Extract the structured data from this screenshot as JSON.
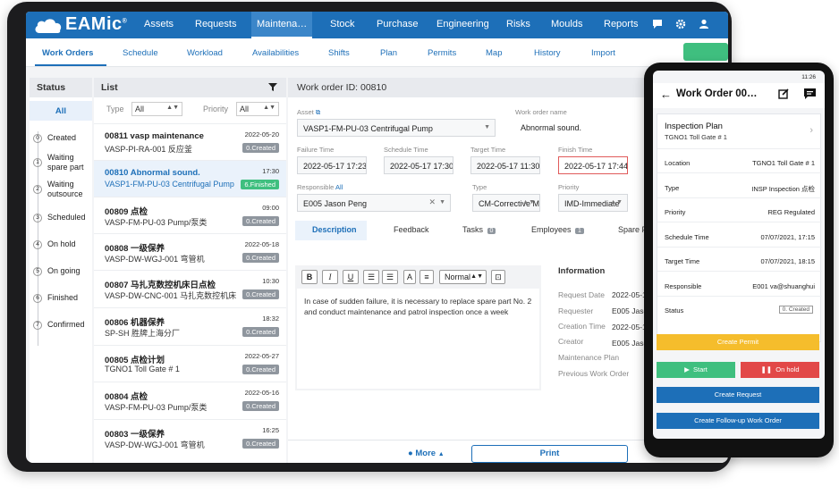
{
  "app": {
    "logo": "EAMic",
    "logo_mark": "®",
    "nav": [
      "Assets",
      "Requests",
      "Maintena…",
      "Stock",
      "Purchase",
      "Engineering",
      "Risks",
      "Moulds",
      "Reports"
    ],
    "subnav": [
      "Work Orders",
      "Schedule",
      "Workload",
      "Availabilities",
      "Shifts",
      "Plan",
      "Permits",
      "Map",
      "History",
      "Import"
    ]
  },
  "status": {
    "header": "Status",
    "all": "All",
    "items": [
      {
        "num": "0",
        "label": "Created"
      },
      {
        "num": "1",
        "label": "Waiting spare part"
      },
      {
        "num": "2",
        "label": "Waiting outsource"
      },
      {
        "num": "3",
        "label": "Scheduled"
      },
      {
        "num": "4",
        "label": "On hold"
      },
      {
        "num": "5",
        "label": "On going"
      },
      {
        "num": "6",
        "label": "Finished"
      },
      {
        "num": "7",
        "label": "Confirmed"
      }
    ]
  },
  "list": {
    "header": "List",
    "type_label": "Type",
    "type_value": "All",
    "priority_label": "Priority",
    "priority_value": "All",
    "rows": [
      {
        "title": "00811 vasp maintenance",
        "sub": "VASP-PI-RA-001 反应釜",
        "date": "2022-05-20",
        "badge": "0.Created"
      },
      {
        "title": "00810 Abnormal sound.",
        "sub": "VASP1-FM-PU-03 Centrifugal Pump",
        "date": "17:30",
        "badge": "6.Finished"
      },
      {
        "title": "00809 点检",
        "sub": "VASP-FM-PU-03 Pump/泵类",
        "date": "09:00",
        "badge": "0.Created"
      },
      {
        "title": "00808 一级保养",
        "sub": "VASP-DW-WGJ-001 弯管机",
        "date": "2022-05-18",
        "badge": "0.Created"
      },
      {
        "title": "00807 马扎克数控机床日点检",
        "sub": "VASP-DW-CNC-001 马扎克数控机床",
        "date": "10:30",
        "badge": "0.Created"
      },
      {
        "title": "00806 机器保养",
        "sub": "SP-SH 胜牌上海分厂",
        "date": "18:32",
        "badge": "0.Created"
      },
      {
        "title": "00805 点检计划",
        "sub": "TGNO1 Toll Gate # 1",
        "date": "2022-05-27",
        "badge": "0.Created"
      },
      {
        "title": "00804 点检",
        "sub": "VASP-FM-PU-03 Pump/泵类",
        "date": "2022-05-16",
        "badge": "0.Created"
      },
      {
        "title": "00803 一级保养",
        "sub": "VASP-DW-WGJ-001 弯管机",
        "date": "16:25",
        "badge": "0.Created"
      }
    ]
  },
  "detail": {
    "header": "Work order ID: 00810",
    "asset_label": "Asset",
    "asset_value": "VASP1-FM-PU-03 Centrifugal Pump",
    "woname_label": "Work order name",
    "woname_value": "Abnormal sound.",
    "failure_label": "Failure Time",
    "failure_value": "2022-05-17 17:23",
    "schedule_label": "Schedule Time",
    "schedule_value": "2022-05-17 17:30",
    "target_label": "Target Time",
    "target_value": "2022-05-17 11:30",
    "finish_label": "Finish Time",
    "finish_value": "2022-05-17 17:44",
    "responsible_label": "Responsible",
    "responsible_all": "All",
    "responsible_value": "E005 Jason Peng",
    "type_label": "Type",
    "type_value": "CM-Corrective M",
    "priority_label": "Priority",
    "priority_value": "IMD-Immediate",
    "tabs": {
      "description": "Description",
      "feedback": "Feedback",
      "tasks": "Tasks",
      "tasks_count": "0",
      "employees": "Employees",
      "employees_count": "1",
      "spare": "Spare P"
    },
    "editor_format": "Normal",
    "description_text": "In case of sudden failure, it is necessary to replace spare part No. 2 and conduct maintenance and patrol inspection once a week",
    "info": {
      "title": "Information",
      "rows": [
        {
          "label": "Request Date",
          "value": "2022-05-1"
        },
        {
          "label": "Requester",
          "value": "E005 Jaso"
        },
        {
          "label": "Creation Time",
          "value": "2022-05-1"
        },
        {
          "label": "Creator",
          "value": "E005 Jaso"
        },
        {
          "label": "Maintenance Plan",
          "value": ""
        },
        {
          "label": "Previous Work Order",
          "value": ""
        }
      ]
    },
    "more": "More",
    "print": "Print"
  },
  "phone": {
    "time": "11:26",
    "title": "Work Order 00…",
    "plan_title": "Inspection Plan",
    "plan_sub": "TGNO1 Toll Gate # 1",
    "rows": [
      {
        "label": "Location",
        "value": "TGNO1 Toll Gate # 1"
      },
      {
        "label": "Type",
        "value": "INSP Inspection 点检"
      },
      {
        "label": "Priority",
        "value": "REG Regulated"
      },
      {
        "label": "Schedule Time",
        "value": "07/07/2021, 17:15"
      },
      {
        "label": "Target Time",
        "value": "07/07/2021, 18:15"
      },
      {
        "label": "Responsible",
        "value": "E001 va@shuanghui"
      }
    ],
    "status_label": "Status",
    "status_value": "0. Created",
    "create_permit": "Create Permit",
    "start": "Start",
    "on_hold": "On hold",
    "create_request": "Create Request",
    "create_followup": "Create Follow-up Work Order",
    "colors": {
      "permit": "#f5bd2c",
      "start": "#3fbf7f",
      "hold": "#e24848",
      "blue": "#1d6fb8"
    }
  }
}
